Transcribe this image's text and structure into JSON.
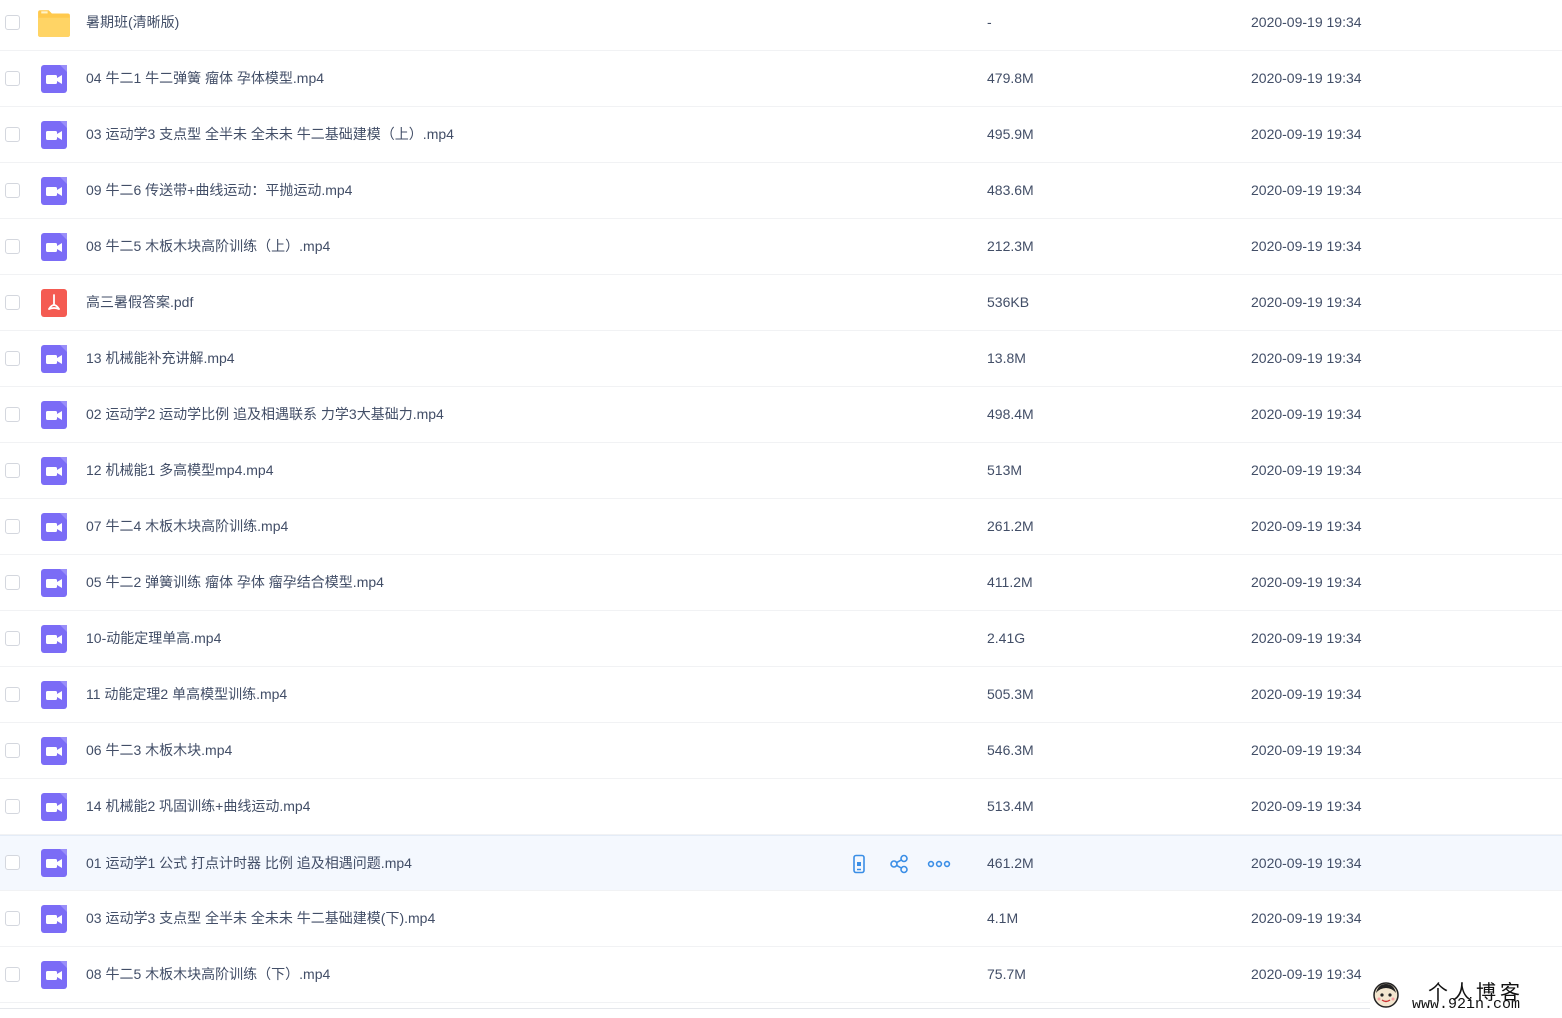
{
  "files": [
    {
      "name": "暑期班(清晰版)",
      "size": "-",
      "date": "2020-09-19 19:34",
      "type": "folder"
    },
    {
      "name": "04 牛二1 牛二弹簧 瘤体 孕体模型.mp4",
      "size": "479.8M",
      "date": "2020-09-19 19:34",
      "type": "video"
    },
    {
      "name": "03 运动学3 支点型 全半未 全未未 牛二基础建模（上）.mp4",
      "size": "495.9M",
      "date": "2020-09-19 19:34",
      "type": "video"
    },
    {
      "name": "09 牛二6 传送带+曲线运动：平抛运动.mp4",
      "size": "483.6M",
      "date": "2020-09-19 19:34",
      "type": "video"
    },
    {
      "name": "08 牛二5 木板木块高阶训练（上）.mp4",
      "size": "212.3M",
      "date": "2020-09-19 19:34",
      "type": "video"
    },
    {
      "name": "高三暑假答案.pdf",
      "size": "536KB",
      "date": "2020-09-19 19:34",
      "type": "pdf"
    },
    {
      "name": "13 机械能补充讲解.mp4",
      "size": "13.8M",
      "date": "2020-09-19 19:34",
      "type": "video"
    },
    {
      "name": "02 运动学2 运动学比例 追及相遇联系 力学3大基础力.mp4",
      "size": "498.4M",
      "date": "2020-09-19 19:34",
      "type": "video"
    },
    {
      "name": "12 机械能1 多高模型mp4.mp4",
      "size": "513M",
      "date": "2020-09-19 19:34",
      "type": "video"
    },
    {
      "name": "07 牛二4 木板木块高阶训练.mp4",
      "size": "261.2M",
      "date": "2020-09-19 19:34",
      "type": "video"
    },
    {
      "name": "05 牛二2 弹簧训练 瘤体 孕体 瘤孕结合模型.mp4",
      "size": "411.2M",
      "date": "2020-09-19 19:34",
      "type": "video"
    },
    {
      "name": "10-动能定理单高.mp4",
      "size": "2.41G",
      "date": "2020-09-19 19:34",
      "type": "video"
    },
    {
      "name": "11 动能定理2 单高模型训练.mp4",
      "size": "505.3M",
      "date": "2020-09-19 19:34",
      "type": "video"
    },
    {
      "name": "06 牛二3 木板木块.mp4",
      "size": "546.3M",
      "date": "2020-09-19 19:34",
      "type": "video"
    },
    {
      "name": "14 机械能2 巩固训练+曲线运动.mp4",
      "size": "513.4M",
      "date": "2020-09-19 19:34",
      "type": "video"
    },
    {
      "name": "01 运动学1 公式 打点计时器 比例 追及相遇问题.mp4",
      "size": "461.2M",
      "date": "2020-09-19 19:34",
      "type": "video",
      "hovered": true
    },
    {
      "name": "03 运动学3 支点型 全半未 全未未 牛二基础建模(下).mp4",
      "size": "4.1M",
      "date": "2020-09-19 19:34",
      "type": "video"
    },
    {
      "name": "08 牛二5 木板木块高阶训练（下）.mp4",
      "size": "75.7M",
      "date": "2020-09-19 19:34",
      "type": "video"
    }
  ],
  "row_actions": [
    "phone-icon",
    "share-icon",
    "more-icon"
  ],
  "icons": {
    "folder": "folder-icon",
    "video": "video-file-icon",
    "pdf": "pdf-file-icon"
  },
  "colors": {
    "text": "#424e67",
    "video_icon": "#7b6cf6",
    "folder_icon": "#ffc94d",
    "pdf_icon": "#f45b52",
    "action_icon": "#3a8ee6",
    "hover_row": "#f4f8fe"
  },
  "watermark": {
    "title": "个人博客",
    "url": "www.92in.com"
  }
}
